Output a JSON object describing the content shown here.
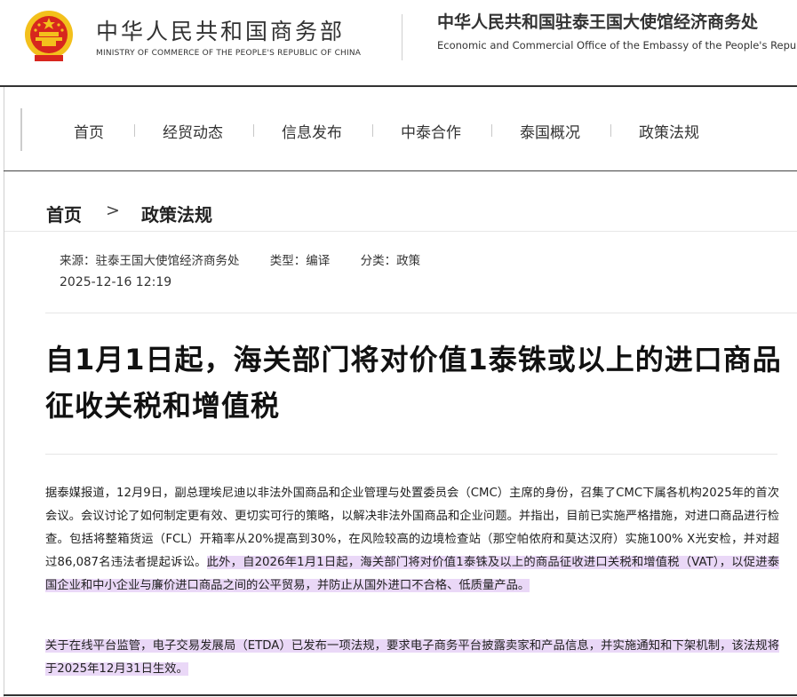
{
  "header": {
    "ministry_cn": "中华人民共和国商务部",
    "ministry_en": "MINISTRY OF COMMERCE OF THE PEOPLE'S REPUBLIC OF CHINA",
    "office_cn": "中华人民共和国驻泰王国大使馆经济商务处",
    "office_en": "Economic and Commercial Office of the Embassy of the People's Repu"
  },
  "nav": {
    "items": [
      {
        "label": "首页"
      },
      {
        "label": "经贸动态"
      },
      {
        "label": "信息发布"
      },
      {
        "label": "中泰合作"
      },
      {
        "label": "泰国概况"
      },
      {
        "label": "政策法规"
      }
    ]
  },
  "breadcrumb": {
    "home": "首页",
    "separator": ">",
    "current": "政策法规"
  },
  "meta": {
    "source": "来源：驻泰王国大使馆经济商务处",
    "type": "类型：编译",
    "category": "分类：政策",
    "date": "2025-12-16 12:19"
  },
  "article": {
    "title": "自1月1日起，海关部门将对价值1泰铢或以上的进口商品征收关税和增值税",
    "p1_plain": "据泰媒报道，12月9日，副总理埃尼迪以非法外国商品和企业管理与处置委员会（CMC）主席的身份，召集了CMC下属各机构2025年的首次会议。会议讨论了如何制定更有效、更切实可行的策略，以解决非法外国商品和企业问题。并指出，目前已实施严格措施，对进口商品进行检查。包括将整箱货运（FCL）开箱率从20%提高到30%，在风险较高的边境检查站（那空帕侬府和莫达汉府）实施100% X光安检，并对超过86,087名违法者提起诉讼。",
    "p1_highlight": "此外，自2026年1月1日起，海关部门将对价值1泰铢及以上的商品征收进口关税和增值税（VAT），以促进泰国企业和中小企业与廉价进口商品之间的公平贸易，并防止从国外进口不合格、低质量产品。",
    "p2_highlight": "关于在线平台监管，电子交易发展局（ETDA）已发布一项法规，要求电子商务平台披露卖家和产品信息，并实施通知和下架机制，该法规将于2025年12月31日生效。"
  },
  "colors": {
    "highlight": "#ead8f7",
    "emblem_red": "#d7261e",
    "emblem_gold": "#f3c01c"
  }
}
